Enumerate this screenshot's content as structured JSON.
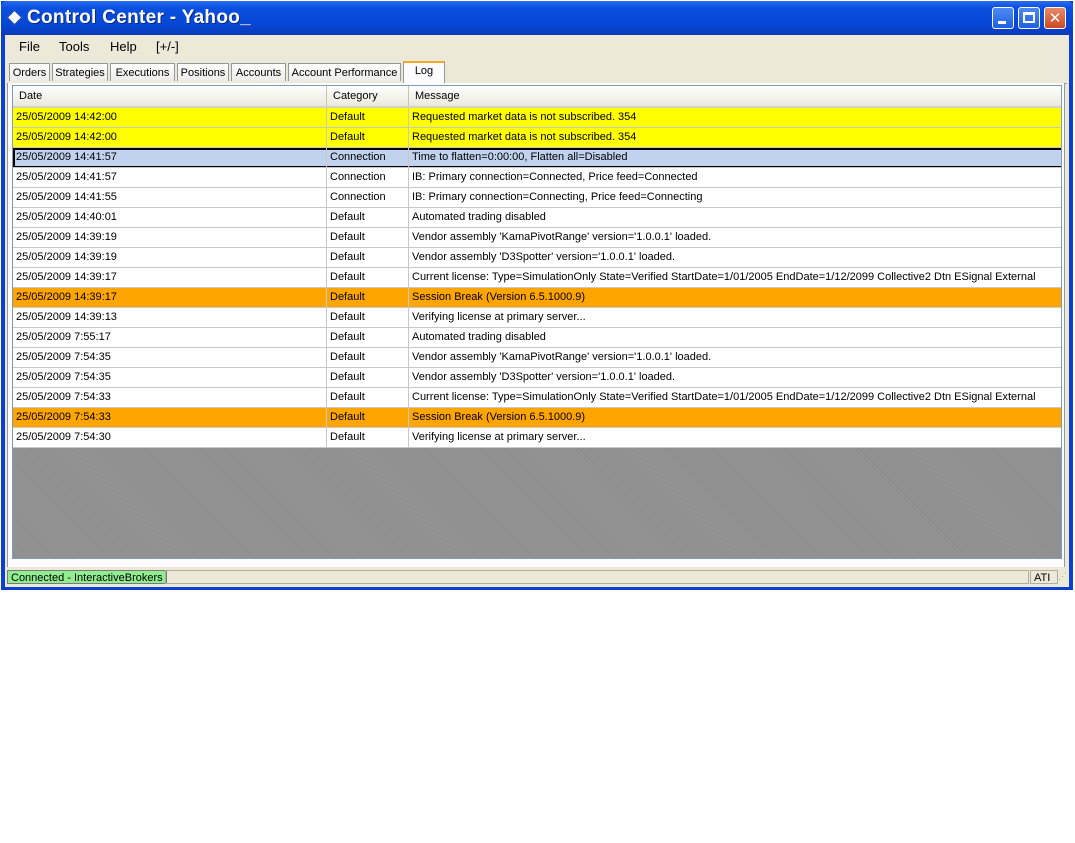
{
  "window": {
    "title": "Control Center - Yahoo_"
  },
  "menu": [
    "File",
    "Tools",
    "Help",
    "[+/-]"
  ],
  "tabs": [
    "Orders",
    "Strategies",
    "Executions",
    "Positions",
    "Accounts",
    "Account Performance",
    "Log"
  ],
  "active_tab": "Log",
  "columns": [
    "Date",
    "Category",
    "Message"
  ],
  "rows": [
    {
      "date": "25/05/2009 14:42:00",
      "category": "Default",
      "message": "Requested market data is not subscribed. 354",
      "highlight": "yellow"
    },
    {
      "date": "25/05/2009 14:42:00",
      "category": "Default",
      "message": "Requested market data is not subscribed. 354",
      "highlight": "yellow"
    },
    {
      "date": "25/05/2009 14:41:57",
      "category": "Connection",
      "message": "Time to flatten=0:00:00, Flatten all=Disabled",
      "highlight": "selected"
    },
    {
      "date": "25/05/2009 14:41:57",
      "category": "Connection",
      "message": "IB: Primary connection=Connected, Price feed=Connected",
      "highlight": "none"
    },
    {
      "date": "25/05/2009 14:41:55",
      "category": "Connection",
      "message": "IB: Primary connection=Connecting, Price feed=Connecting",
      "highlight": "none"
    },
    {
      "date": "25/05/2009 14:40:01",
      "category": "Default",
      "message": "Automated trading disabled",
      "highlight": "none"
    },
    {
      "date": "25/05/2009 14:39:19",
      "category": "Default",
      "message": "Vendor assembly 'KamaPivotRange' version='1.0.0.1' loaded.",
      "highlight": "none"
    },
    {
      "date": "25/05/2009 14:39:19",
      "category": "Default",
      "message": "Vendor assembly 'D3Spotter' version='1.0.0.1' loaded.",
      "highlight": "none"
    },
    {
      "date": "25/05/2009 14:39:17",
      "category": "Default",
      "message": "Current license: Type=SimulationOnly State=Verified StartDate=1/01/2005 EndDate=1/12/2099 Collective2 Dtn ESignal External",
      "highlight": "none"
    },
    {
      "date": "25/05/2009 14:39:17",
      "category": "Default",
      "message": "Session Break (Version 6.5.1000.9)",
      "highlight": "orange"
    },
    {
      "date": "25/05/2009 14:39:13",
      "category": "Default",
      "message": "Verifying license at primary server...",
      "highlight": "none"
    },
    {
      "date": "25/05/2009 7:55:17",
      "category": "Default",
      "message": "Automated trading disabled",
      "highlight": "none"
    },
    {
      "date": "25/05/2009 7:54:35",
      "category": "Default",
      "message": "Vendor assembly 'KamaPivotRange' version='1.0.0.1' loaded.",
      "highlight": "none"
    },
    {
      "date": "25/05/2009 7:54:35",
      "category": "Default",
      "message": "Vendor assembly 'D3Spotter' version='1.0.0.1' loaded.",
      "highlight": "none"
    },
    {
      "date": "25/05/2009 7:54:33",
      "category": "Default",
      "message": "Current license: Type=SimulationOnly State=Verified StartDate=1/01/2005 EndDate=1/12/2099 Collective2 Dtn ESignal External",
      "highlight": "none"
    },
    {
      "date": "25/05/2009 7:54:33",
      "category": "Default",
      "message": "Session Break (Version 6.5.1000.9)",
      "highlight": "orange"
    },
    {
      "date": "25/05/2009 7:54:30",
      "category": "Default",
      "message": "Verifying license at primary server...",
      "highlight": "none"
    }
  ],
  "status": {
    "connection": "Connected - InteractiveBrokers",
    "right": "ATI"
  },
  "colors": {
    "yellow_row": "#ffff00",
    "orange_row": "#ffa500",
    "selected_row": "#c1d2ee",
    "connected_status": "#90ee90",
    "titlebar": "#0646d4"
  },
  "icons": {
    "title": "diamond-icon",
    "minimize": "minimize-icon",
    "maximize": "maximize-icon",
    "close": "close-icon"
  }
}
